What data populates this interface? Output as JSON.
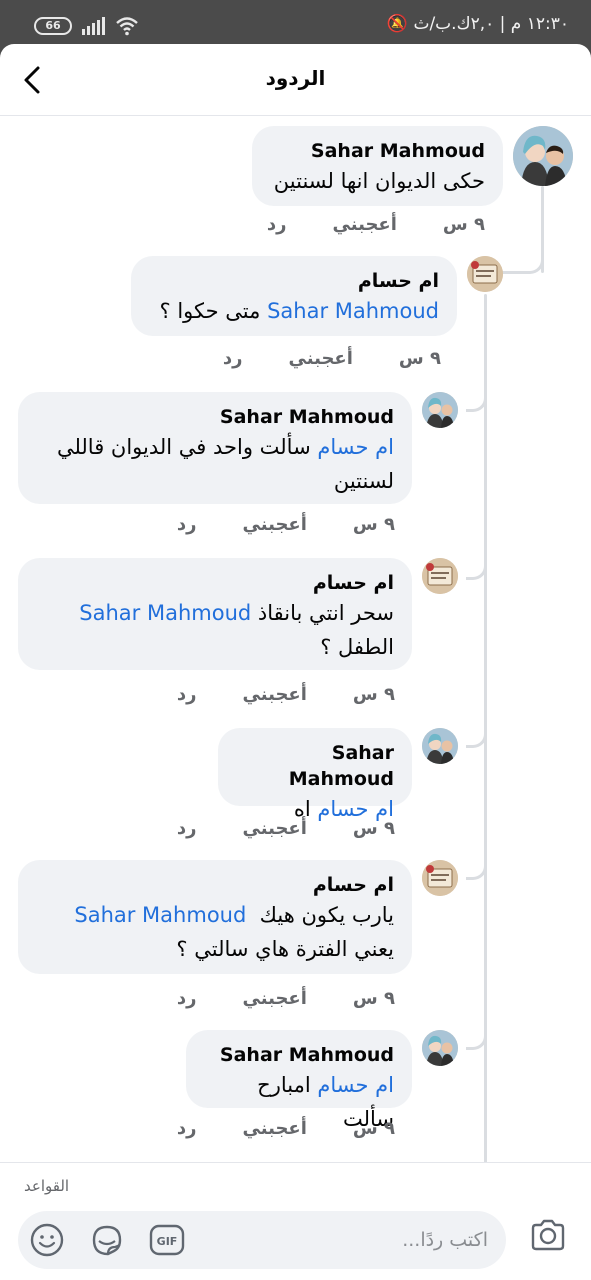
{
  "status": {
    "time": "١٢:٣٠ م | ٢,٠ك.ب/ث",
    "battery": "66"
  },
  "header": {
    "title": "الردود"
  },
  "comments": [
    {
      "name": "Sahar Mahmoud",
      "mention": "",
      "text": "حكى الديوان انها لسنتين",
      "text2": "",
      "time": "٩ س",
      "like": "أعجبني",
      "reply": "رد"
    },
    {
      "name": "ام حسام",
      "mention": "Sahar Mahmoud",
      "text": "متى حكوا ؟",
      "text2": "",
      "time": "٩ س",
      "like": "أعجبني",
      "reply": "رد"
    },
    {
      "name": "Sahar Mahmoud",
      "mention": "ام حسام",
      "text": "سألت واحد في الديوان قاللي",
      "text2": "لسنتين",
      "time": "٩ س",
      "like": "أعجبني",
      "reply": "رد"
    },
    {
      "name": "ام حسام",
      "mention": "Sahar Mahmoud",
      "text": "سحر انتي بانقاذ",
      "text2": "الطفل ؟",
      "time": "٩ س",
      "like": "أعجبني",
      "reply": "رد"
    },
    {
      "name": "Sahar Mahmoud",
      "mention": "ام حسام",
      "text": "اه",
      "text2": "",
      "time": "٩ س",
      "like": "أعجبني",
      "reply": "رد"
    },
    {
      "name": "ام حسام",
      "mention": "Sahar Mahmoud",
      "text": "يارب يكون هيك",
      "text2": "يعني الفترة هاي سالتي ؟",
      "time": "٩ س",
      "like": "أعجبني",
      "reply": "رد"
    },
    {
      "name": "Sahar Mahmoud",
      "mention": "ام حسام",
      "text": "امبارح سألت",
      "text2": "",
      "time": "٩ س",
      "like": "أعجبني",
      "reply": "رد"
    }
  ],
  "footer": {
    "rules": "القواعد",
    "placeholder": "اكتب ردًا..."
  },
  "icons": [
    "back-icon",
    "emoji-icon",
    "sticker-icon",
    "gif-icon",
    "camera-icon"
  ]
}
